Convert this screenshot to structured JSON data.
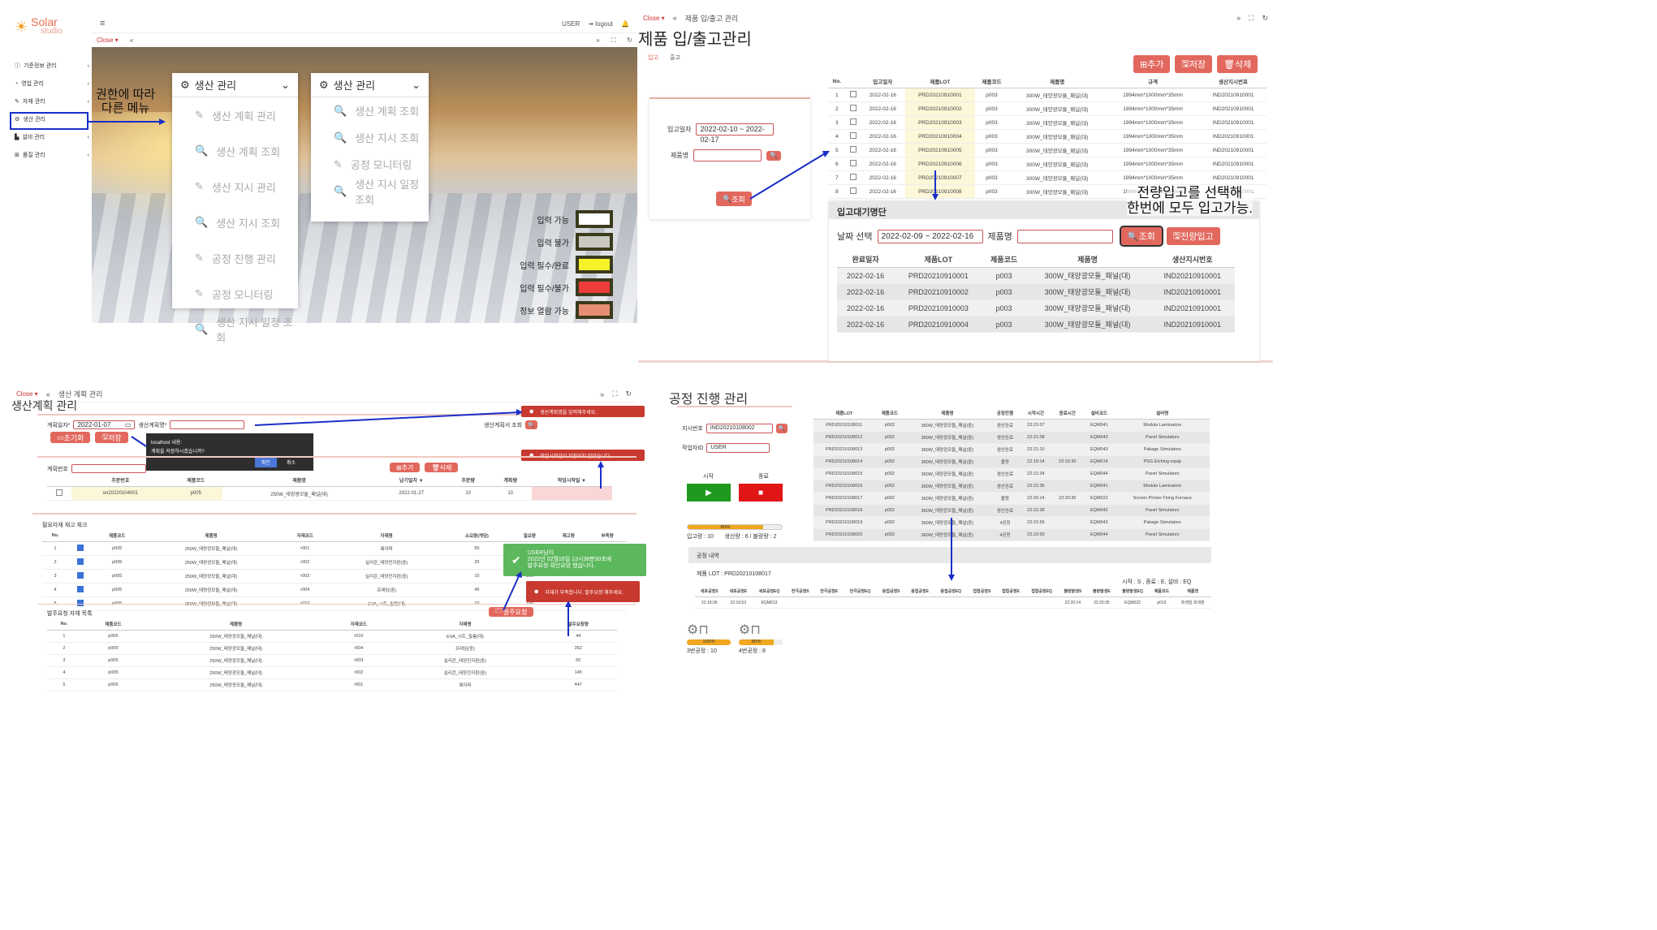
{
  "q1": {
    "brand": "Solar",
    "brand_sub": "studio",
    "user": "USER",
    "logout": "logout",
    "close": "Close",
    "sidebar": [
      "기준정보 관리",
      "영업 관리",
      "자재 관리",
      "생산 관리",
      "설비 관리",
      "품질 관리"
    ],
    "annotation": "권한에 따라\n다른 메뉴",
    "menu1": {
      "title": "생산 관리",
      "items": [
        "생산 계획 관리",
        "생산 계획 조회",
        "생산 지시 관리",
        "생산 지시 조회",
        "공정 진행 관리",
        "공정 모니터링",
        "생산 지시 일정 조회"
      ]
    },
    "menu2": {
      "title": "생산 관리",
      "items": [
        "생산 계획 조회",
        "생산 지시 조회",
        "공정 모니터링",
        "생산 지시 일정 조회"
      ]
    },
    "legend": [
      {
        "label": "입력 가능",
        "color": "#ffffff"
      },
      {
        "label": "입력 불가",
        "color": "#c8c8c0"
      },
      {
        "label": "입력 필수/완료",
        "color": "#f5f22a"
      },
      {
        "label": "입력 필수/불가",
        "color": "#ee3b3b"
      },
      {
        "label": "정보 열람 가능",
        "color": "#e88e72"
      }
    ]
  },
  "q2": {
    "close": "Close",
    "breadcrumb": "제품 입/출고 관리",
    "title": "제품 입/출고관리",
    "tabs": [
      "입고",
      "출고"
    ],
    "buttons": [
      "추가",
      "저장",
      "삭제"
    ],
    "date_label": "입고일자",
    "date_value": "2022-02-10 ~ 2022-02-17",
    "name_label": "제품명",
    "search": "조회",
    "headers": [
      "No.",
      "",
      "입고일자",
      "제품LOT",
      "제품코드",
      "제품명",
      "규격",
      "생산지시번호"
    ],
    "rows": [
      [
        "1",
        "2022-02-16",
        "PRD20210910001",
        "p003",
        "300W_태양광모듈_패널(대)",
        "1994mm*1000mm*35mm",
        "IND20210910001"
      ],
      [
        "2",
        "2022-02-16",
        "PRD20210910002",
        "p003",
        "300W_태양광모듈_패널(대)",
        "1994mm*1000mm*35mm",
        "IND20210910001"
      ],
      [
        "3",
        "2022-02-16",
        "PRD20210910003",
        "p003",
        "300W_태양광모듈_패널(대)",
        "1994mm*1000mm*35mm",
        "IND20210910001"
      ],
      [
        "4",
        "2022-02-16",
        "PRD20210910004",
        "p003",
        "300W_태양광모듈_패널(대)",
        "1994mm*1000mm*35mm",
        "IND20210910001"
      ],
      [
        "5",
        "2022-02-16",
        "PRD20210910005",
        "p003",
        "300W_태양광모듈_패널(대)",
        "1994mm*1000mm*35mm",
        "IND20210910001"
      ],
      [
        "6",
        "2022-02-16",
        "PRD20210910006",
        "p003",
        "300W_태양광모듈_패널(대)",
        "1994mm*1000mm*35mm",
        "IND20210910001"
      ],
      [
        "7",
        "2022-02-16",
        "PRD20210910007",
        "p003",
        "300W_태양광모듈_패널(대)",
        "1994mm*1000mm*35mm",
        "IND20210910001"
      ],
      [
        "8",
        "2022-02-16",
        "PRD20210910008",
        "p003",
        "300W_태양광모듈_패널(대)",
        "1994mm*1000mm*35mm",
        "IND20210910001"
      ]
    ],
    "wait_title": "입고대기명단",
    "wait_date_label": "날짜 선택",
    "wait_date": "2022-02-09 ~ 2022-02-16",
    "wait_name_label": "제품명",
    "wait_search": "조회",
    "wait_all": "전량입고",
    "annotation": "전량입고를 선택해\n한번에 모두 입고가능.",
    "wait_headers": [
      "완료일자",
      "제품LOT",
      "제품코드",
      "제품명",
      "생산지시번호"
    ],
    "wait_rows": [
      [
        "2022-02-16",
        "PRD20210910001",
        "p003",
        "300W_태양광모듈_패널(대)",
        "IND20210910001"
      ],
      [
        "2022-02-16",
        "PRD20210910002",
        "p003",
        "300W_태양광모듈_패널(대)",
        "IND20210910001"
      ],
      [
        "2022-02-16",
        "PRD20210910003",
        "p003",
        "300W_태양광모듈_패널(대)",
        "IND20210910001"
      ],
      [
        "2022-02-16",
        "PRD20210910004",
        "p003",
        "300W_태양광모듈_패널(대)",
        "IND20210910001"
      ]
    ]
  },
  "q3": {
    "close": "Close",
    "breadcrumb": "생산 계획 관리",
    "title": "생산계획 관리",
    "date_label": "계획일자*",
    "date_value": "2022-01-07",
    "name_label": "생산계획명*",
    "plan_query": "생산계획서 조회",
    "reset": "초기화",
    "save": "저장",
    "dlg_title": "localhost 내용:",
    "dlg_msg": "계획을 저장하시겠습니까?",
    "dlg_ok": "확인",
    "dlg_cancel": "취소",
    "toast1": "생산계획명을 입력해주세요.",
    "toast2": "작업시작일이 지정되지 않았습니다.",
    "plan_no_label": "계획번호",
    "add": "추가",
    "del": "삭제",
    "plan_headers": [
      "",
      "주문번호",
      "제품코드",
      "제품명",
      "납기일자 ▼",
      "주문량",
      "계획량",
      "작업시작일 ▼"
    ],
    "plan_row": [
      "on20220104001",
      "p005",
      "250W_태양광모듈_패널(대)",
      "2022-01-27",
      "10",
      "10",
      ""
    ],
    "mat_title": "필요자재 재고 체크",
    "mat_headers": [
      "No.",
      "",
      "제품코드",
      "제품명",
      "자재코드",
      "자재명",
      "소요량(개당)",
      "필요량",
      "재고량",
      "부족량"
    ],
    "mat_rows": [
      [
        "1",
        "p005",
        "250W_태양광모듈_패널(대)",
        "r001",
        "웨이퍼",
        "50",
        "500",
        "",
        ""
      ],
      [
        "2",
        "p005",
        "250W_태양광모듈_패널(대)",
        "r002",
        "실리콘_태양전지판(중)",
        "20",
        "200",
        "",
        ""
      ],
      [
        "3",
        "p005",
        "250W_태양광모듈_패널(대)",
        "r003",
        "실리콘_태양전지판(중)",
        "10",
        "100",
        "",
        ""
      ],
      [
        "4",
        "p005",
        "250W_태양광모듈_패널(대)",
        "r004",
        "프레임(중)",
        "40",
        "400",
        "",
        ""
      ],
      [
        "5",
        "p005",
        "250W_태양광모듈_패널(대)",
        "r010",
        "EVA_시트_필름(대)",
        "10",
        "100",
        "",
        ""
      ]
    ],
    "toast3": "USER님이\n2022년 02월16일 13시38분30초에\n발주요청 확인요망 했습니다.",
    "toast4": "자재가 부족합니다. 발주요청 해주세요.",
    "order_btn": "발주요청",
    "ord_title": "발주요청 자재 목록",
    "ord_headers": [
      "No.",
      "제품코드",
      "제품명",
      "자재코드",
      "자재명",
      "발주요청량"
    ],
    "ord_rows": [
      [
        "1",
        "p005",
        "250W_태양광모듈_패널(대)",
        "r010",
        "EVA_시트_필름(대)",
        "44"
      ],
      [
        "2",
        "p005",
        "250W_태양광모듈_패널(대)",
        "r004",
        "프레임(중)",
        "352"
      ],
      [
        "3",
        "p005",
        "250W_태양광모듈_패널(대)",
        "r003",
        "실리콘_태양전지판(중)",
        "50"
      ],
      [
        "4",
        "p005",
        "250W_태양광모듈_패널(대)",
        "r002",
        "실리콘_태양전지판(중)",
        "145"
      ],
      [
        "5",
        "p005",
        "250W_태양광모듈_패널(대)",
        "r001",
        "웨이퍼",
        "447"
      ]
    ]
  },
  "q4": {
    "title": "공정 진행 관리",
    "order_label": "지시번호",
    "order_value": "IND20210108002",
    "worker_label": "작업자ID",
    "worker_value": "USER",
    "start": "시작",
    "stop": "종료",
    "progress": "80%",
    "progress_value": 0.8,
    "summary": "입고량 : 10       생산량 : 6 / 불량량 : 2",
    "headers": [
      "제품LOT",
      "제품코드",
      "제품명",
      "공정진행",
      "시작시간",
      "종료시간",
      "설비코드",
      "설비명"
    ],
    "rows": [
      [
        "PRD20210108011",
        "p002",
        "360W_태양광모듈_패널(중)",
        "생산완료",
        "22:21:07",
        "",
        "EQM041",
        "Module Laminators"
      ],
      [
        "PRD20210108012",
        "p002",
        "360W_태양광모듈_패널(중)",
        "생산완료",
        "22:21:08",
        "",
        "EQM042",
        "Panel Simulators"
      ],
      [
        "PRD20210108013",
        "p002",
        "360W_태양광모듈_패널(중)",
        "생산완료",
        "22:21:10",
        "",
        "EQM043",
        "Pakage Simulators"
      ],
      [
        "PRD20210108014",
        "p002",
        "360W_태양광모듈_패널(중)",
        "불량",
        "22:19:14",
        "22:19:30",
        "EQM014",
        "PSG Etching equip"
      ],
      [
        "PRD20210108015",
        "p002",
        "360W_태양광모듈_패널(중)",
        "생산완료",
        "22:21:34",
        "",
        "EQM044",
        "Panel Simulators"
      ],
      [
        "PRD20210108016",
        "p002",
        "360W_태양광모듈_패널(중)",
        "생산완료",
        "22:21:36",
        "",
        "EQM041",
        "Module Laminators"
      ],
      [
        "PRD20210108017",
        "p002",
        "360W_태양광모듈_패널(중)",
        "불량",
        "22:20:14",
        "22:20:35",
        "EQM022",
        "Screen Printer Firing Furnace"
      ],
      [
        "PRD20210108018",
        "p002",
        "360W_태양광모듈_패널(중)",
        "생산완료",
        "22:21:38",
        "",
        "EQM042",
        "Panel Simulators"
      ],
      [
        "PRD20210108019",
        "p002",
        "360W_태양광모듈_패널(중)",
        "4공정",
        "22:21:59",
        "",
        "EQM043",
        "Pakage Simulators"
      ],
      [
        "PRD20210108020",
        "p002",
        "360W_태양광모듈_패널(중)",
        "4공정",
        "22:22:00",
        "",
        "EQM044",
        "Panel Simulators"
      ]
    ],
    "hist_title": "공정 내역",
    "hist_lot": "제품 LOT : PRD20210108017",
    "hist_legend": "시작 : S , 종료 : E, 설비 : EQ",
    "hist_headers": [
      "세포공정S",
      "세포공정E",
      "세포공정EQ",
      "전극공정S",
      "전극공정E",
      "전극공정EQ",
      "용접공정S",
      "용접공정E",
      "용접공정EQ",
      "접합공정S",
      "접합공정E",
      "접합공정EQ",
      "불량발생S",
      "불량발생E",
      "불량발생EQ",
      "제품코드",
      "제품명"
    ],
    "hist_row": [
      "22:19:36",
      "22:19:53",
      "EQM013",
      "",
      "",
      "",
      "",
      "",
      "",
      "",
      "",
      "",
      "22:20:14",
      "22:20:35",
      "EQM022",
      "p019",
      "프레임 회색판"
    ],
    "st1": {
      "pct": "100%",
      "value": 1,
      "label": "3번공정 : 10"
    },
    "st2": {
      "pct": "80%",
      "value": 0.8,
      "label": "4번공정 : 8"
    }
  }
}
